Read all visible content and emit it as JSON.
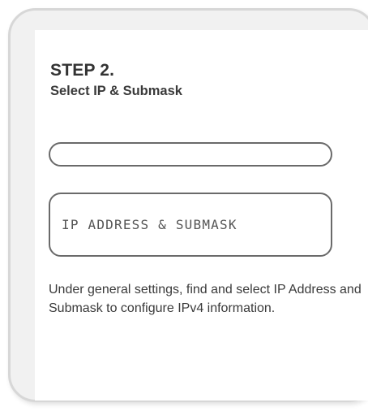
{
  "step": {
    "title": "STEP 2.",
    "subtitle": "Select IP & Submask"
  },
  "fields": {
    "top_field_value": "",
    "ip_box_label": "IP ADDRESS & SUBMASK"
  },
  "description": "Under general settings, find and select IP Address and Submask to configure IPv4 information."
}
